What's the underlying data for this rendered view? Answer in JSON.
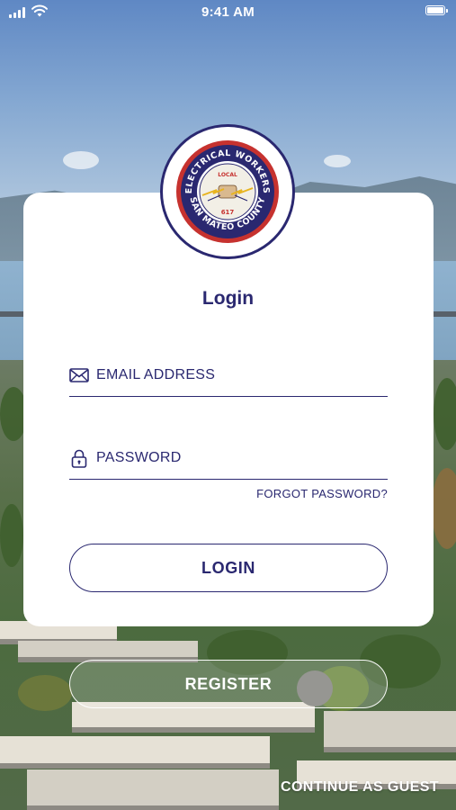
{
  "status_bar": {
    "time": "9:41 AM"
  },
  "logo": {
    "name": "Electrical Workers San Mateo County emblem",
    "text_top": "ELECTRICAL WORKERS",
    "text_bottom": "SAN MATEO COUNTY",
    "local_number_top": "LOCAL",
    "local_number_bottom": "617",
    "ring_color": "#2a2870",
    "accent_color": "#c6322f"
  },
  "form": {
    "title": "Login",
    "email": {
      "placeholder": "EMAIL ADDRESS",
      "value": "",
      "icon": "envelope-icon"
    },
    "password": {
      "placeholder": "PASSWORD",
      "value": "",
      "icon": "lock-icon"
    },
    "forgot_password": "FORGOT PASSWORD?",
    "login_button": "LOGIN"
  },
  "actions": {
    "register_button": "REGISTER",
    "guest_link": "CONTINUE AS GUEST"
  },
  "colors": {
    "primary": "#2a2870",
    "card": "#ffffff"
  }
}
